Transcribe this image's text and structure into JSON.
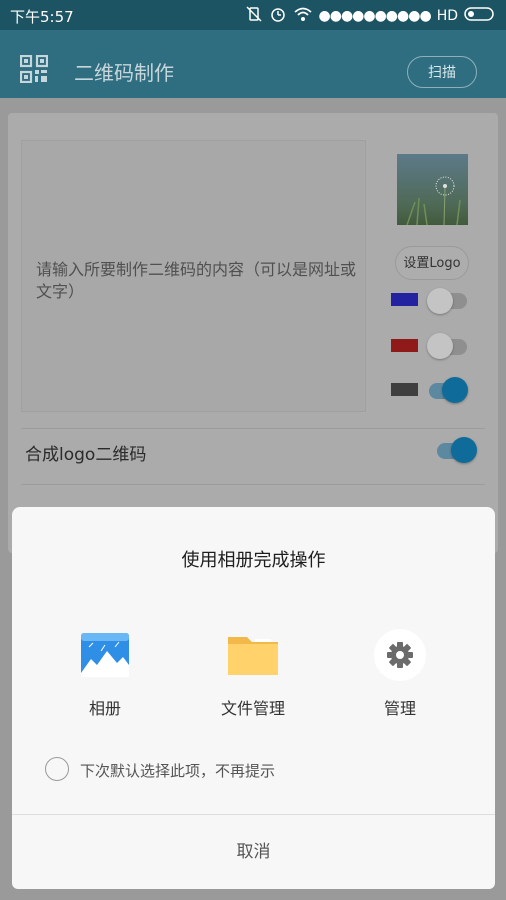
{
  "status_bar": {
    "time": "下午5:57",
    "network": "HD"
  },
  "app_bar": {
    "title": "二维码制作",
    "scan_label": "扫描"
  },
  "form": {
    "content_placeholder": "请输入所要制作二维码的内容（可以是网址或文字）",
    "set_logo_label": "设置Logo",
    "colors": [
      {
        "color": "#0a0aa0",
        "enabled": false
      },
      {
        "color": "#8b0000",
        "enabled": false
      },
      {
        "color": "#2b2b2b",
        "enabled": true
      }
    ],
    "merge_logo_label": "合成logo二维码",
    "merge_logo_enabled": true
  },
  "chooser": {
    "title": "使用相册完成操作",
    "apps": [
      {
        "label": "相册",
        "icon": "gallery-icon"
      },
      {
        "label": "文件管理",
        "icon": "folder-icon"
      },
      {
        "label": "管理",
        "icon": "gear-icon"
      }
    ],
    "remember_label": "下次默认选择此项，不再提示",
    "cancel_label": "取消"
  },
  "accent": "#2e6e80"
}
